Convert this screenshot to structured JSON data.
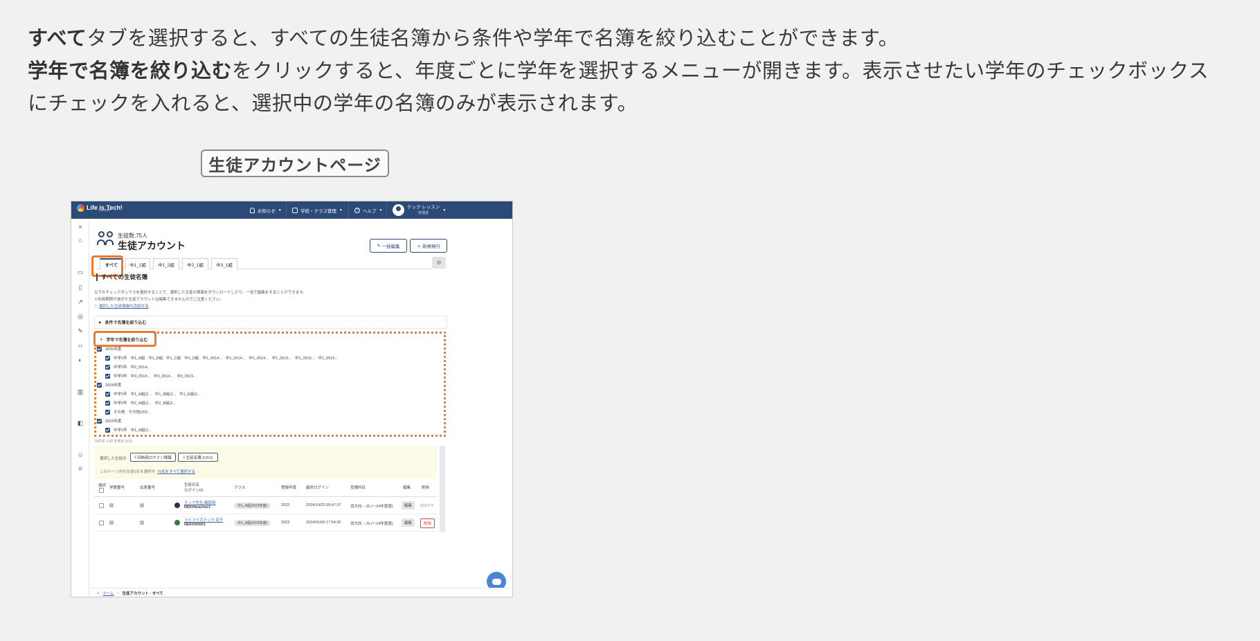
{
  "intro": {
    "line1_bold": "すべて",
    "line1_rest": "タブを選択すると、すべての生徒名簿から条件や学年で名簿を絞り込むことができます。",
    "line2_bold": "学年で名簿を絞り込む",
    "line2_rest": "をクリックすると、年度ごとに学年を選択するメニューが開きます。表示させたい学年のチェックボックスにチェックを入れると、選択中の学年の名簿のみが表示されます。"
  },
  "page_label": "生徒アカウントページ",
  "app": {
    "logo_text": "Life is Tech!",
    "logo_sub": "Lesson",
    "nav": {
      "notice": "お知らせ",
      "school": "学校・クラス管理",
      "help": "ヘルプ",
      "user_name": "テック レッスン",
      "user_role": "管理者"
    },
    "header": {
      "count": "生徒数:75人",
      "title": "生徒アカウント",
      "bulk_edit": "一括編集",
      "new_issue": "＋ 新規発行"
    },
    "tabs": [
      "すべて",
      "中1_1組",
      "中1_2組",
      "中2_1組",
      "中3_1組"
    ],
    "section_title": "すべての生徒名簿",
    "desc1": "以下のチェックボックスを選択することで、選択した生徒の情報をダウンロードしたり、一括で編集をすることができます。",
    "desc2": "※利用期限が過ぎた生徒アカウントは編集できませんのでご注意ください。",
    "desc_link": "選択した生徒情報の活用方法",
    "filter_condition": "条件で名簿を絞り込む",
    "filter_grade": "学年で名簿を絞り込む",
    "grades": [
      {
        "year": "2025年度",
        "rows": [
          {
            "grade": "中学1年",
            "classes": [
              "中1_A組",
              "中1_B組",
              "中1_C組",
              "中1_D組",
              "中1_0514...",
              "中1_0514...",
              "中1_0514...",
              "中1_0515...",
              "中1_0515...",
              "中1_0515..."
            ]
          },
          {
            "grade": "中学2年",
            "classes": [
              "中2_0514..."
            ]
          },
          {
            "grade": "中学3年",
            "classes": [
              "中3_0514...",
              "中3_0514...",
              "中3_0515..."
            ]
          }
        ]
      },
      {
        "year": "2024年度",
        "rows": [
          {
            "grade": "中学1年",
            "classes": [
              "中1_A組(2...",
              "中1_B組(2...",
              "中1_E組(2..."
            ]
          },
          {
            "grade": "中学2年",
            "classes": [
              "中2_A組(2...",
              "中2_B組(2..."
            ]
          },
          {
            "grade": "その他",
            "classes": [
              "その他(202..."
            ]
          }
        ]
      },
      {
        "year": "2023年度",
        "rows": [
          {
            "grade": "中学1年",
            "classes": [
              "中1_A組(2..."
            ]
          }
        ]
      }
    ],
    "results_note": "76件中 1-50 を表示 (1/2)",
    "selected_label": "選択した生徒の",
    "btn_print": "印刷用ログイン情報",
    "btn_csv": "生徒名簿 (CSV)",
    "page_select": "このページ内の生徒0名を選択中",
    "select_all": "75名をすべて選択する",
    "table_headers": {
      "select": "選択",
      "student_no": "学籍番号",
      "attend_no": "出席番号",
      "name": "生徒氏名",
      "login_id": "ログインID",
      "class": "クラス",
      "reg_year": "登録年度",
      "last_login": "最終ログイン",
      "course": "受講科目",
      "edit": "編集",
      "delete": "削除"
    },
    "rows": [
      {
        "name": "テック先生 確認用",
        "id": "NEKHteacher1",
        "class": "中1_A組(2023年度)",
        "year": "2023",
        "last": "2024/10/22 09:47:37",
        "course": "双方向・JS (～24年度版)",
        "edit": "編集",
        "delete": "削除不可"
      },
      {
        "name": "ライフイズテック 花子",
        "id": "NEKH00001",
        "class": "中1_A組(2023年度)",
        "year": "2023",
        "last": "2024/01/05 17:54:30",
        "course": "双方向・JS (～24年度版)",
        "edit": "編集",
        "delete": "削除"
      }
    ],
    "breadcrumb_home": "ホーム",
    "breadcrumb_current": "生徒アカウント - すべて"
  },
  "colors": {
    "navy": "#2b4a78",
    "highlight": "#f07a2e",
    "background": "#f1f1f1"
  }
}
